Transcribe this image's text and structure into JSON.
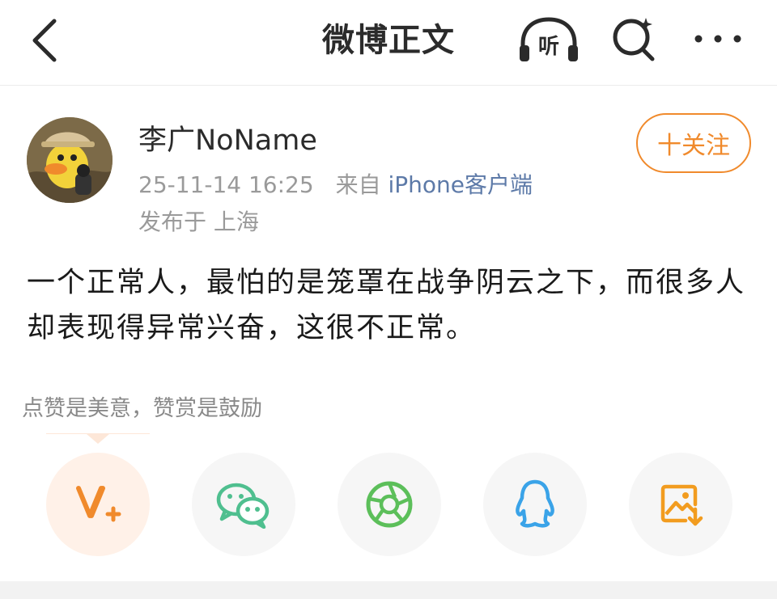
{
  "header": {
    "title": "微博正文",
    "listen_label": "听"
  },
  "author": {
    "name": "李广NoName",
    "time": "25-11-14 16:25",
    "source_prefix": "来自",
    "source_app": "iPhone客户端",
    "location": "发布于 上海",
    "follow_label": "十关注"
  },
  "post": {
    "text": "一个正常人，最怕的是笼罩在战争阴云之下，而很多人却表现得异常兴奋，这很不正常。"
  },
  "reward": {
    "hint": "点赞是美意，赞赏是鼓励"
  },
  "share": [
    {
      "name": "reward-icon"
    },
    {
      "name": "wechat-icon"
    },
    {
      "name": "moments-icon"
    },
    {
      "name": "qq-icon"
    },
    {
      "name": "save-image-icon"
    }
  ],
  "colors": {
    "accent": "#f08a2c",
    "link": "#5d7aa8",
    "wechat": "#4fbf8f",
    "moments": "#5cbf5a",
    "qq": "#3aa3e8",
    "save": "#f29c1f"
  }
}
